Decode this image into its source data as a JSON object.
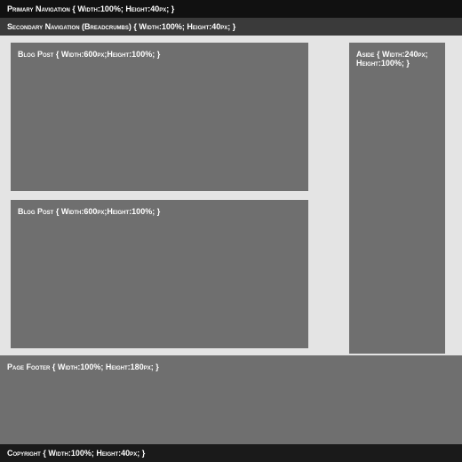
{
  "primary_nav": {
    "label": "Primary Navigation { Width:100%; Height:40px; }"
  },
  "secondary_nav": {
    "label": "Secondary Navigation (Breadcrumbs) { Width:100%; Height:40px; }"
  },
  "blog_post_1": {
    "label": "Blog Post { Width:600px;Height:100%; }"
  },
  "blog_post_2": {
    "label": "Blog Post { Width:600px;Height:100%; }"
  },
  "aside": {
    "label": "Aside { Width:240px; Height:100%; }"
  },
  "footer": {
    "label": "Page Footer { Width:100%; Height:180px; }"
  },
  "copyright": {
    "label": "Copyright { Width:100%; Height:40px; }"
  }
}
